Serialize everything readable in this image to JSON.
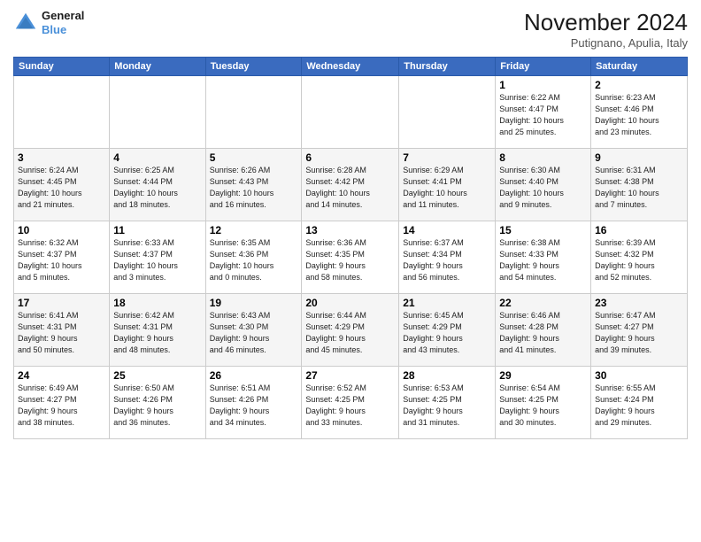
{
  "logo": {
    "line1": "General",
    "line2": "Blue"
  },
  "title": "November 2024",
  "location": "Putignano, Apulia, Italy",
  "headers": [
    "Sunday",
    "Monday",
    "Tuesday",
    "Wednesday",
    "Thursday",
    "Friday",
    "Saturday"
  ],
  "weeks": [
    [
      {
        "day": "",
        "info": ""
      },
      {
        "day": "",
        "info": ""
      },
      {
        "day": "",
        "info": ""
      },
      {
        "day": "",
        "info": ""
      },
      {
        "day": "",
        "info": ""
      },
      {
        "day": "1",
        "info": "Sunrise: 6:22 AM\nSunset: 4:47 PM\nDaylight: 10 hours\nand 25 minutes."
      },
      {
        "day": "2",
        "info": "Sunrise: 6:23 AM\nSunset: 4:46 PM\nDaylight: 10 hours\nand 23 minutes."
      }
    ],
    [
      {
        "day": "3",
        "info": "Sunrise: 6:24 AM\nSunset: 4:45 PM\nDaylight: 10 hours\nand 21 minutes."
      },
      {
        "day": "4",
        "info": "Sunrise: 6:25 AM\nSunset: 4:44 PM\nDaylight: 10 hours\nand 18 minutes."
      },
      {
        "day": "5",
        "info": "Sunrise: 6:26 AM\nSunset: 4:43 PM\nDaylight: 10 hours\nand 16 minutes."
      },
      {
        "day": "6",
        "info": "Sunrise: 6:28 AM\nSunset: 4:42 PM\nDaylight: 10 hours\nand 14 minutes."
      },
      {
        "day": "7",
        "info": "Sunrise: 6:29 AM\nSunset: 4:41 PM\nDaylight: 10 hours\nand 11 minutes."
      },
      {
        "day": "8",
        "info": "Sunrise: 6:30 AM\nSunset: 4:40 PM\nDaylight: 10 hours\nand 9 minutes."
      },
      {
        "day": "9",
        "info": "Sunrise: 6:31 AM\nSunset: 4:38 PM\nDaylight: 10 hours\nand 7 minutes."
      }
    ],
    [
      {
        "day": "10",
        "info": "Sunrise: 6:32 AM\nSunset: 4:37 PM\nDaylight: 10 hours\nand 5 minutes."
      },
      {
        "day": "11",
        "info": "Sunrise: 6:33 AM\nSunset: 4:37 PM\nDaylight: 10 hours\nand 3 minutes."
      },
      {
        "day": "12",
        "info": "Sunrise: 6:35 AM\nSunset: 4:36 PM\nDaylight: 10 hours\nand 0 minutes."
      },
      {
        "day": "13",
        "info": "Sunrise: 6:36 AM\nSunset: 4:35 PM\nDaylight: 9 hours\nand 58 minutes."
      },
      {
        "day": "14",
        "info": "Sunrise: 6:37 AM\nSunset: 4:34 PM\nDaylight: 9 hours\nand 56 minutes."
      },
      {
        "day": "15",
        "info": "Sunrise: 6:38 AM\nSunset: 4:33 PM\nDaylight: 9 hours\nand 54 minutes."
      },
      {
        "day": "16",
        "info": "Sunrise: 6:39 AM\nSunset: 4:32 PM\nDaylight: 9 hours\nand 52 minutes."
      }
    ],
    [
      {
        "day": "17",
        "info": "Sunrise: 6:41 AM\nSunset: 4:31 PM\nDaylight: 9 hours\nand 50 minutes."
      },
      {
        "day": "18",
        "info": "Sunrise: 6:42 AM\nSunset: 4:31 PM\nDaylight: 9 hours\nand 48 minutes."
      },
      {
        "day": "19",
        "info": "Sunrise: 6:43 AM\nSunset: 4:30 PM\nDaylight: 9 hours\nand 46 minutes."
      },
      {
        "day": "20",
        "info": "Sunrise: 6:44 AM\nSunset: 4:29 PM\nDaylight: 9 hours\nand 45 minutes."
      },
      {
        "day": "21",
        "info": "Sunrise: 6:45 AM\nSunset: 4:29 PM\nDaylight: 9 hours\nand 43 minutes."
      },
      {
        "day": "22",
        "info": "Sunrise: 6:46 AM\nSunset: 4:28 PM\nDaylight: 9 hours\nand 41 minutes."
      },
      {
        "day": "23",
        "info": "Sunrise: 6:47 AM\nSunset: 4:27 PM\nDaylight: 9 hours\nand 39 minutes."
      }
    ],
    [
      {
        "day": "24",
        "info": "Sunrise: 6:49 AM\nSunset: 4:27 PM\nDaylight: 9 hours\nand 38 minutes."
      },
      {
        "day": "25",
        "info": "Sunrise: 6:50 AM\nSunset: 4:26 PM\nDaylight: 9 hours\nand 36 minutes."
      },
      {
        "day": "26",
        "info": "Sunrise: 6:51 AM\nSunset: 4:26 PM\nDaylight: 9 hours\nand 34 minutes."
      },
      {
        "day": "27",
        "info": "Sunrise: 6:52 AM\nSunset: 4:25 PM\nDaylight: 9 hours\nand 33 minutes."
      },
      {
        "day": "28",
        "info": "Sunrise: 6:53 AM\nSunset: 4:25 PM\nDaylight: 9 hours\nand 31 minutes."
      },
      {
        "day": "29",
        "info": "Sunrise: 6:54 AM\nSunset: 4:25 PM\nDaylight: 9 hours\nand 30 minutes."
      },
      {
        "day": "30",
        "info": "Sunrise: 6:55 AM\nSunset: 4:24 PM\nDaylight: 9 hours\nand 29 minutes."
      }
    ]
  ]
}
